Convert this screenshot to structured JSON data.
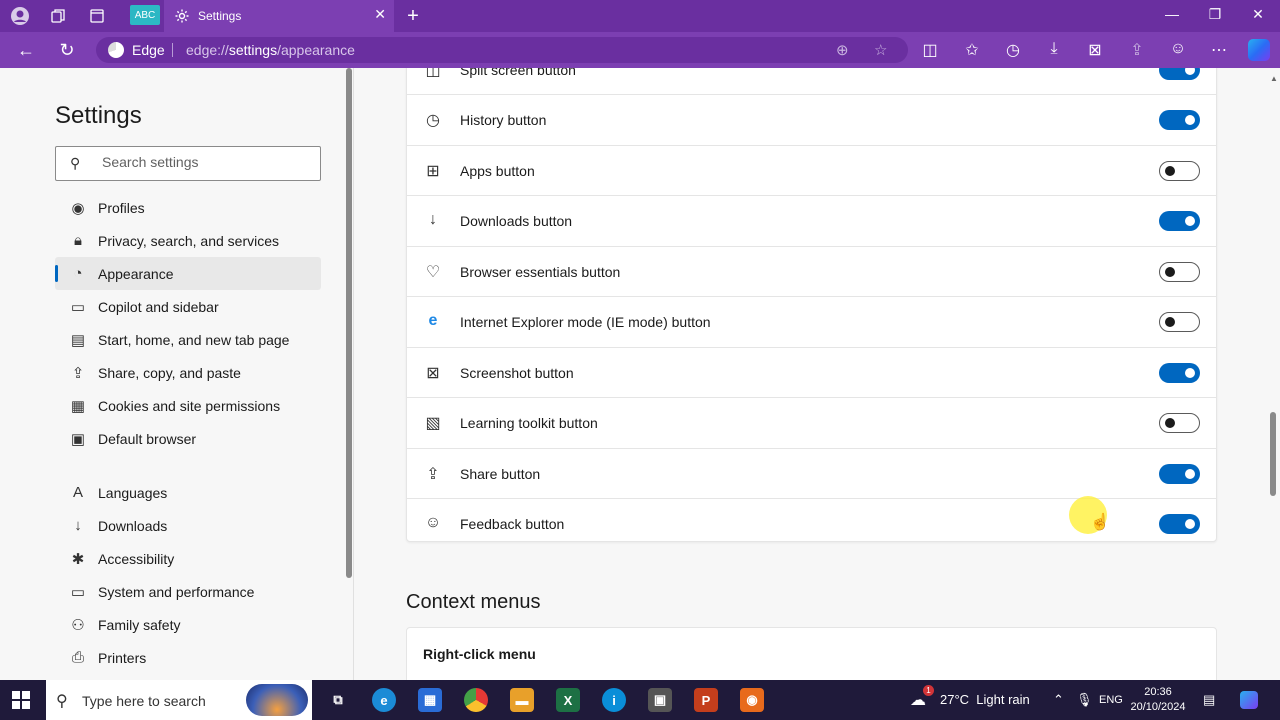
{
  "browser": {
    "profile_badge": "ABC",
    "tab_title": "Settings",
    "edge_label": "Edge",
    "url_prefix": "edge://",
    "url_main": "settings",
    "url_suffix": "/appearance"
  },
  "sidebar": {
    "title": "Settings",
    "search_placeholder": "Search settings",
    "items": [
      {
        "label": "Profiles",
        "icon": "profile-icon"
      },
      {
        "label": "Privacy, search, and services",
        "icon": "lock-icon"
      },
      {
        "label": "Appearance",
        "icon": "appearance-icon",
        "active": true
      },
      {
        "label": "Copilot and sidebar",
        "icon": "sidebar-icon"
      },
      {
        "label": "Start, home, and new tab page",
        "icon": "home-icon"
      },
      {
        "label": "Share, copy, and paste",
        "icon": "share-icon"
      },
      {
        "label": "Cookies and site permissions",
        "icon": "cookies-icon"
      },
      {
        "label": "Default browser",
        "icon": "browser-icon"
      },
      {
        "label": "Languages",
        "icon": "languages-icon"
      },
      {
        "label": "Downloads",
        "icon": "download-icon"
      },
      {
        "label": "Accessibility",
        "icon": "accessibility-icon"
      },
      {
        "label": "System and performance",
        "icon": "system-icon"
      },
      {
        "label": "Family safety",
        "icon": "family-icon"
      },
      {
        "label": "Printers",
        "icon": "printer-icon"
      }
    ]
  },
  "toolbar_buttons": [
    {
      "label": "Split screen button",
      "icon": "split-screen-icon",
      "on": true
    },
    {
      "label": "History button",
      "icon": "history-icon",
      "on": true
    },
    {
      "label": "Apps button",
      "icon": "apps-icon",
      "on": false
    },
    {
      "label": "Downloads button",
      "icon": "download-icon",
      "on": true
    },
    {
      "label": "Browser essentials button",
      "icon": "heart-pulse-icon",
      "on": false
    },
    {
      "label": "Internet Explorer mode (IE mode) button",
      "icon": "ie-icon",
      "on": false
    },
    {
      "label": "Screenshot button",
      "icon": "screenshot-icon",
      "on": true
    },
    {
      "label": "Learning toolkit button",
      "icon": "learning-toolkit-icon",
      "on": false
    },
    {
      "label": "Share button",
      "icon": "share-icon",
      "on": true
    },
    {
      "label": "Feedback button",
      "icon": "feedback-icon",
      "on": true
    }
  ],
  "context_menus": {
    "title": "Context menus",
    "right_click_label": "Right-click menu"
  },
  "taskbar": {
    "search_placeholder": "Type here to search",
    "weather": "27°C  Light rain",
    "weather_badge": "1",
    "language": "ENG",
    "time": "20:36",
    "date": "20/10/2024"
  },
  "colors": {
    "accent": "#0067c0",
    "titlebar": "#6a2fa0",
    "addressbar": "#7c3fb2"
  }
}
